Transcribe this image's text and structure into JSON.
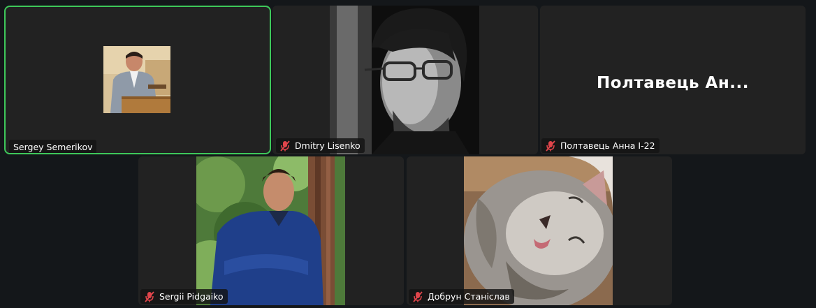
{
  "participants": [
    {
      "name": "Sergey Semerikov",
      "muted": false,
      "active_speaker": true,
      "video": "portrait-at-podium"
    },
    {
      "name": "Dmitry Lisenko",
      "muted": true,
      "video": "bw-portrait-with-glasses"
    },
    {
      "name": "Полтавець Анна І-22",
      "display_name": "Полтавець Ан...",
      "muted": true,
      "video": "none"
    },
    {
      "name": "Sergii Pidgaiko",
      "muted": true,
      "video": "portrait-by-tree"
    },
    {
      "name": "Добрун Станіслав",
      "muted": true,
      "video": "sleeping-cat"
    }
  ],
  "colors": {
    "background": "#14171a",
    "tile": "#222222",
    "active_border": "#3ec85a",
    "mute_icon": "#e0454b"
  },
  "icons": {
    "mute": "microphone-muted-icon"
  }
}
